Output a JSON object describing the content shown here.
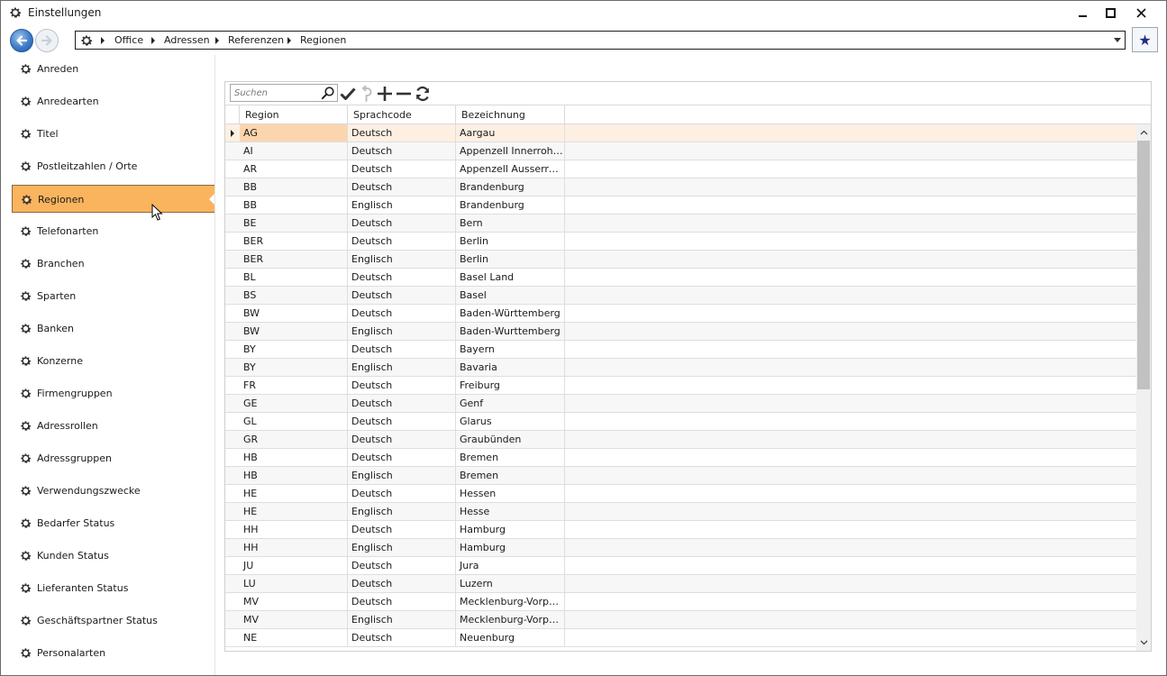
{
  "window": {
    "title": "Einstellungen"
  },
  "breadcrumb": [
    "Office",
    "Adressen",
    "Referenzen",
    "Regionen"
  ],
  "sidebar": {
    "items": [
      {
        "label": "Anreden"
      },
      {
        "label": "Anredearten"
      },
      {
        "label": "Titel"
      },
      {
        "label": "Postleitzahlen / Orte"
      },
      {
        "label": "Regionen",
        "active": true
      },
      {
        "label": "Telefonarten"
      },
      {
        "label": "Branchen"
      },
      {
        "label": "Sparten"
      },
      {
        "label": "Banken"
      },
      {
        "label": "Konzerne"
      },
      {
        "label": "Firmengruppen"
      },
      {
        "label": "Adressrollen"
      },
      {
        "label": "Adressgruppen"
      },
      {
        "label": "Verwendungszwecke"
      },
      {
        "label": "Bedarfer Status"
      },
      {
        "label": "Kunden Status"
      },
      {
        "label": "Lieferanten Status"
      },
      {
        "label": "Geschäftspartner Status"
      },
      {
        "label": "Personalarten"
      }
    ]
  },
  "toolbar": {
    "search_placeholder": "Suchen"
  },
  "grid": {
    "columns": [
      "Region",
      "Sprachcode",
      "Bezeichnung"
    ],
    "rows": [
      [
        "AG",
        "Deutsch",
        "Aargau"
      ],
      [
        "AI",
        "Deutsch",
        "Appenzell Innerrohden"
      ],
      [
        "AR",
        "Deutsch",
        "Appenzell Ausserrohden"
      ],
      [
        "BB",
        "Deutsch",
        "Brandenburg"
      ],
      [
        "BB",
        "Englisch",
        "Brandenburg"
      ],
      [
        "BE",
        "Deutsch",
        "Bern"
      ],
      [
        "BER",
        "Deutsch",
        "Berlin"
      ],
      [
        "BER",
        "Englisch",
        "Berlin"
      ],
      [
        "BL",
        "Deutsch",
        "Basel Land"
      ],
      [
        "BS",
        "Deutsch",
        "Basel"
      ],
      [
        "BW",
        "Deutsch",
        "Baden-Württemberg"
      ],
      [
        "BW",
        "Englisch",
        "Baden-Wurttemberg"
      ],
      [
        "BY",
        "Deutsch",
        "Bayern"
      ],
      [
        "BY",
        "Englisch",
        "Bavaria"
      ],
      [
        "FR",
        "Deutsch",
        "Freiburg"
      ],
      [
        "GE",
        "Deutsch",
        "Genf"
      ],
      [
        "GL",
        "Deutsch",
        "Glarus"
      ],
      [
        "GR",
        "Deutsch",
        "Graubünden"
      ],
      [
        "HB",
        "Deutsch",
        "Bremen"
      ],
      [
        "HB",
        "Englisch",
        "Bremen"
      ],
      [
        "HE",
        "Deutsch",
        "Hessen"
      ],
      [
        "HE",
        "Englisch",
        "Hesse"
      ],
      [
        "HH",
        "Deutsch",
        "Hamburg"
      ],
      [
        "HH",
        "Englisch",
        "Hamburg"
      ],
      [
        "JU",
        "Deutsch",
        "Jura"
      ],
      [
        "LU",
        "Deutsch",
        "Luzern"
      ],
      [
        "MV",
        "Deutsch",
        "Mecklenburg-Vorpommern"
      ],
      [
        "MV",
        "Englisch",
        "Mecklenburg-Vorpommern"
      ],
      [
        "NE",
        "Deutsch",
        "Neuenburg"
      ]
    ],
    "selected_row": 0
  },
  "colors": {
    "active_item": "#fbb45e",
    "selected_row": "#fdf0e3",
    "selected_cell": "#fbd5ae",
    "accent_blue": "#3d7cc9",
    "favorite_star": "#1d2f86"
  }
}
